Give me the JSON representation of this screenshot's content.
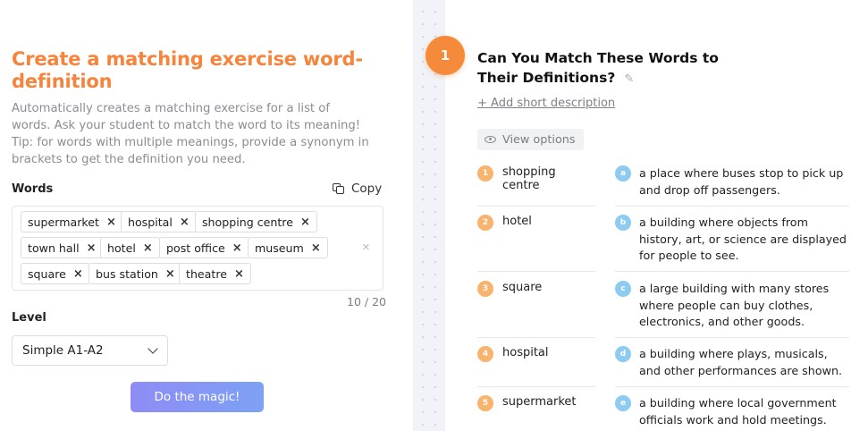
{
  "left": {
    "title": "Create a matching exercise word-definition",
    "description": "Automatically creates a matching exercise for a list of words. Ask your student to match the word to its meaning!   Tip: for words with multiple meanings, provide a synonym in brackets to get the definition you need.",
    "words_label": "Words",
    "copy_label": "Copy",
    "words": [
      "supermarket",
      "hospital",
      "shopping centre",
      "town hall",
      "hotel",
      "post office",
      "museum",
      "square",
      "bus station",
      "theatre"
    ],
    "remove_glyph": "×",
    "clear_glyph": "×",
    "counter": "10 / 20",
    "level_label": "Level",
    "level_value": "Simple A1-A2",
    "magic_button": "Do the magic!"
  },
  "right": {
    "exercise_number": "1",
    "title": "Can You Match These Words to Their Definitions?",
    "pencil_glyph": "✎",
    "add_description": "+ Add short description",
    "view_options": "View options",
    "words": [
      {
        "num": "1",
        "word": "shopping centre"
      },
      {
        "num": "2",
        "word": "hotel"
      },
      {
        "num": "3",
        "word": "square"
      },
      {
        "num": "4",
        "word": "hospital"
      },
      {
        "num": "5",
        "word": "supermarket"
      }
    ],
    "definitions": [
      {
        "letter": "a",
        "text": "a place where buses stop to pick up and drop off passengers."
      },
      {
        "letter": "b",
        "text": "a building where objects from history, art, or science are displayed for people to see."
      },
      {
        "letter": "c",
        "text": "a large building with many stores where people can buy clothes, electronics, and other goods."
      },
      {
        "letter": "d",
        "text": "a building where plays, musicals, and other performances are shown."
      },
      {
        "letter": "e",
        "text": "a building where local government officials work and hold meetings."
      }
    ]
  },
  "colors": {
    "accent_orange": "#f58a3b",
    "title_orange": "#f5843c",
    "number_circle": "#f8b36c",
    "letter_circle": "#8dcbf1",
    "button_gradient_start": "#8f8cf5",
    "button_gradient_end": "#7da1f5"
  }
}
